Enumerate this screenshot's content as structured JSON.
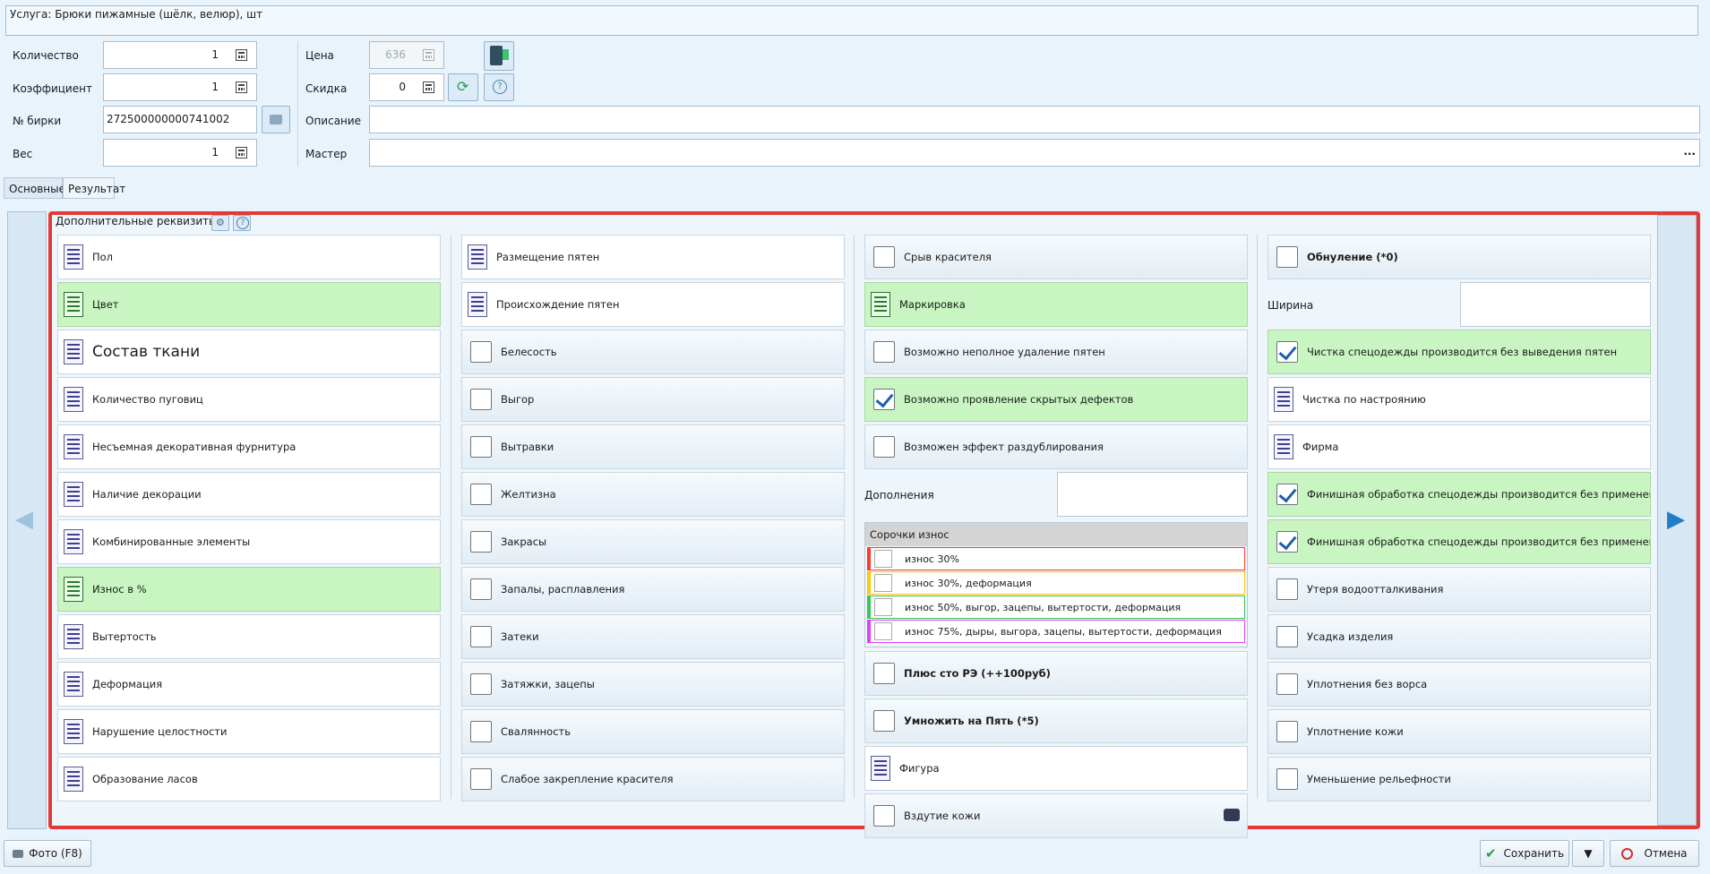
{
  "service": {
    "label": "Услуга: Брюки пижамные (шёлк, велюр), шт"
  },
  "form": {
    "quantity_label": "Количество",
    "quantity_value": "1",
    "coefficient_label": "Коэффициент",
    "coefficient_value": "1",
    "tag_label": "№ бирки",
    "tag_value": "272500000000741002",
    "weight_label": "Вес",
    "weight_value": "1",
    "price_label": "Цена",
    "price_value": "636",
    "discount_label": "Скидка",
    "discount_value": "0",
    "description_label": "Описание",
    "description_value": "",
    "master_label": "Мастер",
    "master_value": "",
    "master_ellipsis": "..."
  },
  "tabs": [
    {
      "label": "Основные"
    },
    {
      "label": "Результат"
    }
  ],
  "panel": {
    "title": "Дополнительные реквизиты"
  },
  "col1": [
    {
      "label": "Пол",
      "type": "list",
      "green": false
    },
    {
      "label": "Цвет",
      "type": "list",
      "green": true
    },
    {
      "label": "Состав ткани",
      "type": "list",
      "green": false,
      "big": true
    },
    {
      "label": "Количество пуговиц",
      "type": "list",
      "green": false
    },
    {
      "label": "Несъемная декоративная фурнитура",
      "type": "list",
      "green": false
    },
    {
      "label": "Наличие декорации",
      "type": "list",
      "green": false
    },
    {
      "label": "Комбинированные элементы",
      "type": "list",
      "green": false
    },
    {
      "label": "Износ в %",
      "type": "list",
      "green": true
    },
    {
      "label": "Вытертость",
      "type": "list",
      "green": false
    },
    {
      "label": "Деформация",
      "type": "list",
      "green": false
    },
    {
      "label": "Нарушение целостности",
      "type": "list",
      "green": false
    },
    {
      "label": "Образование ласов",
      "type": "list",
      "green": false
    }
  ],
  "col2": [
    {
      "label": "Размещение пятен",
      "type": "list"
    },
    {
      "label": "Происхождение пятен",
      "type": "list"
    },
    {
      "label": "Белесость",
      "type": "check",
      "checked": false
    },
    {
      "label": "Выгор",
      "type": "check",
      "checked": false
    },
    {
      "label": "Вытравки",
      "type": "check",
      "checked": false
    },
    {
      "label": "Желтизна",
      "type": "check",
      "checked": false
    },
    {
      "label": "Закрасы",
      "type": "check",
      "checked": false
    },
    {
      "label": "Запалы, расплавления",
      "type": "check",
      "checked": false
    },
    {
      "label": "Затеки",
      "type": "check",
      "checked": false
    },
    {
      "label": "Затяжки, зацепы",
      "type": "check",
      "checked": false
    },
    {
      "label": "Свалянность",
      "type": "check",
      "checked": false
    },
    {
      "label": "Слабое закрепление красителя",
      "type": "check",
      "checked": false
    }
  ],
  "col3": {
    "top": [
      {
        "label": "Срыв красителя",
        "type": "check",
        "checked": false
      },
      {
        "label": "Маркировка",
        "type": "list",
        "green": true
      },
      {
        "label": "Возможно неполное удаление пятен",
        "type": "check",
        "checked": false
      },
      {
        "label": "Возможно проявление скрытых дефектов",
        "type": "check",
        "checked": true,
        "green": true
      },
      {
        "label": "Возможен эффект раздублирования",
        "type": "check",
        "checked": false
      }
    ],
    "additions_label": "Дополнения",
    "group_title": "Сорочки износ",
    "group_options": [
      {
        "label": "износ 30%",
        "color": "#ff3b30"
      },
      {
        "label": "износ 30%, деформация",
        "color": "#ffcc00"
      },
      {
        "label": "износ 50%, выгор, зацепы, вытертости, деформация",
        "color": "#34c759"
      },
      {
        "label": "износ 75%, дыры, выгора, зацепы, вытертости, деформация",
        "color": "#e040fb"
      }
    ],
    "bottom": [
      {
        "label": "Плюс сто РЭ (++100руб)",
        "type": "check",
        "checked": false,
        "bold": true
      },
      {
        "label": "Умножить на Пять (*5)",
        "type": "check",
        "checked": false,
        "bold": true
      },
      {
        "label": "Фигура",
        "type": "list"
      },
      {
        "label": "Вздутие кожи",
        "type": "check",
        "checked": false
      }
    ]
  },
  "col4": {
    "first": {
      "label": "Обнуление (*0)",
      "bold": true
    },
    "width_label": "Ширина",
    "items": [
      {
        "label": "Чистка спецодежды производится без выведения пятен",
        "type": "check",
        "checked": true,
        "green": true
      },
      {
        "label": "Чистка по настроянию",
        "type": "list"
      },
      {
        "label": "Фирма",
        "type": "list"
      },
      {
        "label": "Финишная обработка спецодежды производится без применения",
        "type": "check",
        "checked": true,
        "green": true
      },
      {
        "label": "Финишная обработка спецодежды производится без применения",
        "type": "check",
        "checked": true,
        "green": true
      },
      {
        "label": "Утеря водоотталкивания",
        "type": "check",
        "checked": false
      },
      {
        "label": "Усадка изделия",
        "type": "check",
        "checked": false
      },
      {
        "label": "Уплотнения без ворса",
        "type": "check",
        "checked": false
      },
      {
        "label": "Уплотнение кожи",
        "type": "check",
        "checked": false
      },
      {
        "label": "Уменьшение рельефности",
        "type": "check",
        "checked": false
      }
    ]
  },
  "footer": {
    "photo_label": "Фото (F8)",
    "save_label": "Сохранить",
    "cancel_label": "Отмена"
  },
  "colors": {
    "green": "#c8f5c2",
    "red_border": "#e53935",
    "accent": "#1e5fa8"
  }
}
